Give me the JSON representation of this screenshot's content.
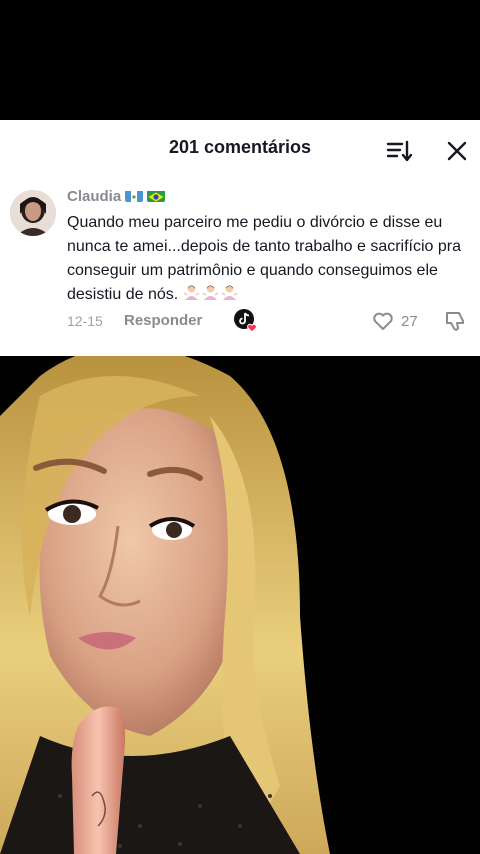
{
  "header": {
    "title": "201 comentários",
    "sort_icon": "sort-icon",
    "close_icon": "close-icon"
  },
  "comment": {
    "username": "Claudia",
    "flags": [
      "guatemala-flag",
      "brazil-flag"
    ],
    "text": "Quando meu parceiro me pediu o divórcio e disse eu nunca te amei...depois de tanto trabalho e sacrifício pra conseguir um patrimônio e quando conseguimos ele desistiu de nós.",
    "trailing_emojis": [
      "woman-shrugging-emoji",
      "woman-shrugging-emoji",
      "woman-shrugging-emoji"
    ],
    "date": "12-15",
    "reply_label": "Responder",
    "likes": "27"
  },
  "colors": {
    "card_bg": "#ffffff",
    "title": "#161823",
    "muted": "#8a8b91",
    "like_heart": "#fe2c55"
  }
}
